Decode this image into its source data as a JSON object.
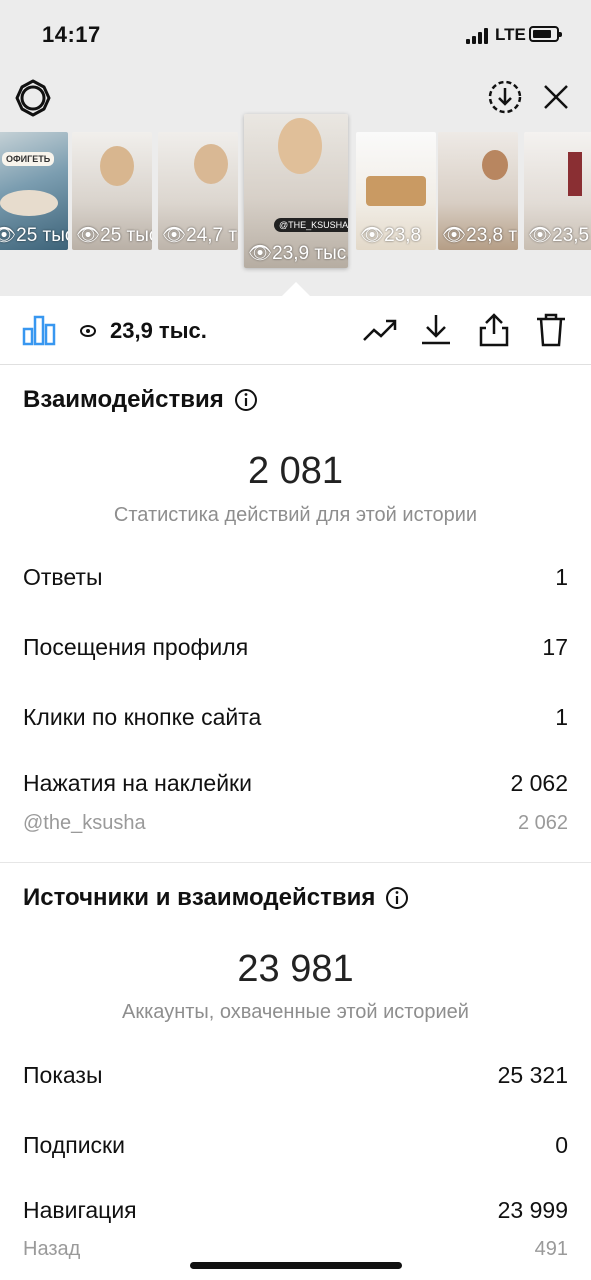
{
  "status_bar": {
    "time": "14:17",
    "network": "LTE"
  },
  "thumbnails": [
    {
      "views": "25 тыс",
      "caption": "ОФИГЕТЬ"
    },
    {
      "views": "25 тыс"
    },
    {
      "views": "24,7 т"
    },
    {
      "views": "23,9 тыс.",
      "selected": true,
      "tag": "@THE_KSUSHA"
    },
    {
      "views": "23,8"
    },
    {
      "views": "23,8 т"
    },
    {
      "views": "23,5"
    }
  ],
  "toolbar": {
    "views": "23,9 тыс."
  },
  "interactions": {
    "title": "Взаимодействия",
    "total": "2 081",
    "caption": "Статистика действий для этой истории",
    "rows": [
      {
        "label": "Ответы",
        "value": "1"
      },
      {
        "label": "Посещения профиля",
        "value": "17"
      },
      {
        "label": "Клики по кнопке сайта",
        "value": "1"
      },
      {
        "label": "Нажатия на наклейки",
        "value": "2 062"
      }
    ],
    "sticker": {
      "label": "@the_ksusha",
      "value": "2 062"
    }
  },
  "discovery": {
    "title": "Источники и взаимодействия",
    "total": "23 981",
    "caption": "Аккаунты, охваченные этой историей",
    "rows": [
      {
        "label": "Показы",
        "value": "25 321"
      },
      {
        "label": "Подписки",
        "value": "0"
      },
      {
        "label": "Навигация",
        "value": "23 999"
      }
    ],
    "navigation_sub": [
      {
        "label": "Назад",
        "value": "491"
      }
    ]
  },
  "colors": {
    "accent": "#3897f0",
    "muted": "#8e8e8e",
    "header_bg": "#ececec"
  }
}
